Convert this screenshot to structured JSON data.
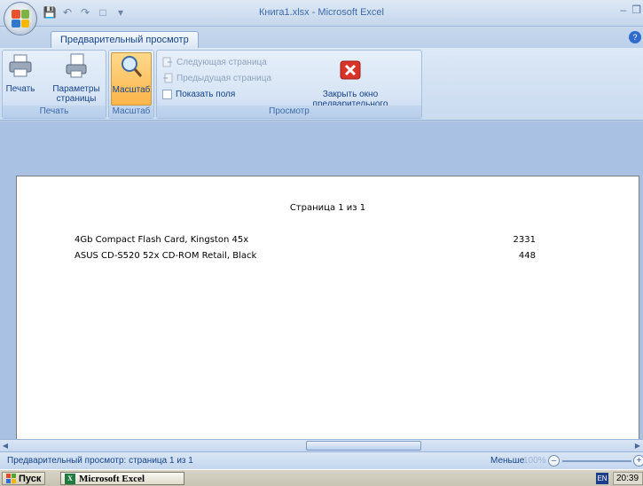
{
  "window": {
    "title": "Книга1.xlsx - Microsoft Excel"
  },
  "ribbon": {
    "active_tab": "Предварительный просмотр",
    "groups": {
      "print": {
        "label": "Печать",
        "print_button": "Печать",
        "page_setup_button": "Параметры страницы"
      },
      "zoom": {
        "label": "Масштаб",
        "zoom_button": "Масштаб"
      },
      "preview": {
        "label": "Просмотр",
        "next_page": "Следующая страница",
        "prev_page": "Предыдущая страница",
        "show_margins": "Показать поля",
        "close_preview": "Закрыть окно предварительного просмотра"
      }
    }
  },
  "page": {
    "header": "Страница 1 из 1",
    "rows": [
      {
        "name": "4Gb Compact Flash Card, Kingston 45x",
        "qty": "2331"
      },
      {
        "name": "ASUS CD-S520 52x CD-ROM Retail, Black",
        "qty": "448"
      }
    ]
  },
  "statusbar": {
    "text": "Предварительный просмотр: страница 1 из 1",
    "zoom_less": "Меньше",
    "zoom_level": "100%"
  },
  "taskbar": {
    "start_label": "Пуск",
    "task_label": "Microsoft Excel",
    "lang": "EN",
    "clock": "20:39"
  },
  "colors": {
    "ribbon_bg": "#dce8f6",
    "workspace_bg": "#a9c1e2",
    "selected_button": "#fbb44a",
    "close_icon_red": "#d9342b"
  },
  "icons": {
    "print": "printer-icon",
    "page_setup": "page-setup-icon",
    "zoom": "magnifier-icon",
    "next": "next-page-icon",
    "prev": "prev-page-icon",
    "close": "close-preview-icon"
  }
}
